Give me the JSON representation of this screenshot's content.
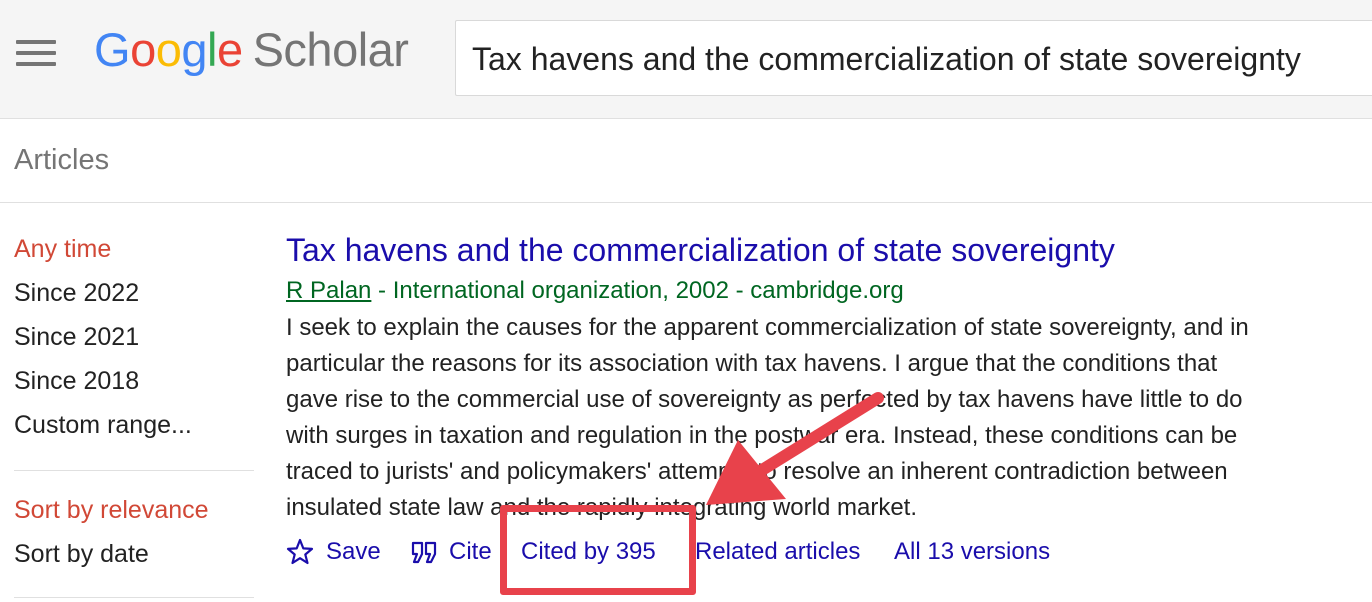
{
  "header": {
    "logo_google": [
      "G",
      "o",
      "o",
      "g",
      "l",
      "e"
    ],
    "logo_scholar": "Scholar",
    "search_value": "Tax havens and the commercialization of state sovereignty"
  },
  "section_title": "Articles",
  "sidebar": {
    "time_filters": [
      "Any time",
      "Since 2022",
      "Since 2021",
      "Since 2018",
      "Custom range..."
    ],
    "sort_options": [
      "Sort by relevance",
      "Sort by date"
    ]
  },
  "result": {
    "title": "Tax havens and the commercialization of state sovereignty",
    "author": "R Palan",
    "meta_rest": " - International organization, 2002 - cambridge.org",
    "snippet_lines": [
      "I seek to explain the causes for the apparent commercialization of state sovereignty, and in",
      "particular the reasons for its association with tax havens. I argue that the conditions that",
      "gave rise to the commercial use of sovereignty as perfected by tax havens have little to do",
      "with surges in taxation and regulation in the postwar era. Instead, these conditions can be",
      "traced to jurists' and policymakers' attempts to resolve an inherent contradiction between",
      "insulated state law and the rapidly integrating world market."
    ],
    "actions": {
      "save": "Save",
      "cite": "Cite",
      "cited_by": "Cited by 395",
      "related": "Related articles",
      "versions": "All 13 versions"
    }
  },
  "colors": {
    "link_blue": "#1a0dab",
    "meta_green": "#006621",
    "active_red": "#d14836",
    "annotation_red": "#e8424b"
  },
  "icons": {
    "menu": "hamburger-menu-icon",
    "save": "star-outline-icon",
    "cite": "quote-icon"
  }
}
